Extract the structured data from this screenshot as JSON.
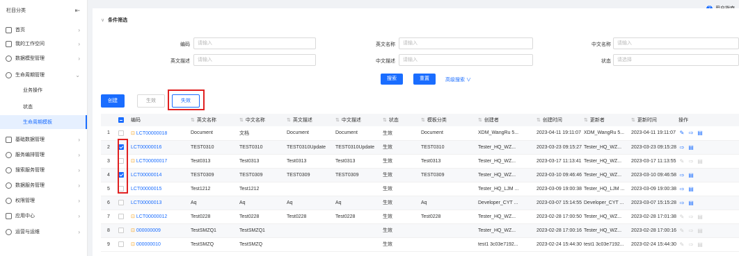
{
  "sidebar": {
    "title": "栏目分类",
    "collapse_icon": "collapse-icon",
    "items": [
      {
        "label": "首页",
        "icon": "home-icon"
      },
      {
        "label": "我的工作空间",
        "icon": "workspace-icon"
      },
      {
        "label": "数据模型管理",
        "icon": "model-icon"
      },
      {
        "label": "生命周期管理",
        "icon": "lifecycle-icon"
      },
      {
        "label": "基础数据管理",
        "icon": "database-icon"
      },
      {
        "label": "服务编排管理",
        "icon": "service-icon"
      },
      {
        "label": "搜索服务管理",
        "icon": "search-service-icon"
      },
      {
        "label": "数据服务管理",
        "icon": "data-service-icon"
      },
      {
        "label": "权限管理",
        "icon": "permission-icon"
      },
      {
        "label": "应用中心",
        "icon": "app-icon"
      },
      {
        "label": "运营与运维",
        "icon": "ops-icon"
      }
    ],
    "sub_items": [
      {
        "label": "业务操作"
      },
      {
        "label": "状态"
      },
      {
        "label": "生命周期模板"
      }
    ]
  },
  "header": {
    "help_label": "用户指南"
  },
  "filter": {
    "title": "条件筛选",
    "fields": [
      {
        "label": "编码",
        "placeholder": "请输入"
      },
      {
        "label": "英文名称",
        "placeholder": "请输入"
      },
      {
        "label": "中文名称",
        "placeholder": "请输入"
      },
      {
        "label": "英文描述",
        "placeholder": "请输入"
      },
      {
        "label": "中文描述",
        "placeholder": "请输入"
      },
      {
        "label": "状态",
        "placeholder": "请选择"
      }
    ],
    "search_label": "搜索",
    "reset_label": "重置",
    "advanced_label": "高级搜索 ∨"
  },
  "toolbar": {
    "create_label": "创建",
    "enable_label": "生效",
    "disable_label": "失效"
  },
  "table": {
    "columns": [
      "编码",
      "英文名称",
      "中文名称",
      "英文描述",
      "中文描述",
      "状态",
      "模板分类",
      "创建者",
      "创建时间",
      "更新者",
      "更新时间",
      "操作"
    ],
    "rows": [
      {
        "no": "1",
        "checked": false,
        "locked": true,
        "code": "LCT00000018",
        "en": "Document",
        "cn": "文档",
        "en_desc": "Document",
        "cn_desc": "Document",
        "status": "生效",
        "category": "Document",
        "creator": "XDM_WangRu 5...",
        "created": "2023-04-11 19:11:07",
        "updater": "XDM_WangRu 5...",
        "updated": "2023-04-11 19:11:07",
        "actions_active": true
      },
      {
        "no": "2",
        "checked": true,
        "locked": false,
        "code": "LCT00000016",
        "en": "TEST0310",
        "cn": "TEST0310",
        "en_desc": "TEST0310Update",
        "cn_desc": "TEST0310Update",
        "status": "生效",
        "category": "TEST0310",
        "creator": "Tester_HQ_WZ...",
        "created": "2023-03-23 09:15:27",
        "updater": "Tester_HQ_WZ...",
        "updated": "2023-03-23 09:15:28",
        "actions_active": true
      },
      {
        "no": "3",
        "checked": false,
        "locked": true,
        "code": "LCT00000017",
        "en": "Test0313",
        "cn": "Test0313",
        "en_desc": "Test0313",
        "cn_desc": "Test0313",
        "status": "生效",
        "category": "Test0313",
        "creator": "Tester_HQ_WZ...",
        "created": "2023-03-17 11:13:41",
        "updater": "Tester_HQ_WZ...",
        "updated": "2023-03-17 11:13:55",
        "actions_active": false
      },
      {
        "no": "4",
        "checked": true,
        "locked": false,
        "code": "LCT00000014",
        "en": "TEST0309",
        "cn": "TEST0309",
        "en_desc": "TEST0309",
        "cn_desc": "TEST0309",
        "status": "生效",
        "category": "TEST0309",
        "creator": "Tester_HQ_WZ...",
        "created": "2023-03-10 09:46:46",
        "updater": "Tester_HQ_WZ...",
        "updated": "2023-03-10 09:46:58",
        "actions_active": true
      },
      {
        "no": "5",
        "checked": false,
        "locked": false,
        "code": "LCT00000015",
        "en": "Test1212",
        "cn": "Test1212",
        "en_desc": "",
        "cn_desc": "",
        "status": "生效",
        "category": "",
        "creator": "Tester_HQ_LJM ...",
        "created": "2023-03-09 19:00:38",
        "updater": "Tester_HQ_LJM ...",
        "updated": "2023-03-09 19:00:38",
        "actions_active": true
      },
      {
        "no": "6",
        "checked": false,
        "locked": false,
        "code": "LCT00000013",
        "en": "Aq",
        "cn": "Aq",
        "en_desc": "Aq",
        "cn_desc": "Aq",
        "status": "生效",
        "category": "Aq",
        "creator": "Developer_CYT ...",
        "created": "2023-03-07 15:14:55",
        "updater": "Developer_CYT ...",
        "updated": "2023-03-07 15:15:28",
        "actions_active": true
      },
      {
        "no": "7",
        "checked": false,
        "locked": true,
        "code": "LCT00000012",
        "en": "Test0228",
        "cn": "Test0228",
        "en_desc": "Test0228",
        "cn_desc": "Test0228",
        "status": "生效",
        "category": "Test0228",
        "creator": "Tester_HQ_WZ...",
        "created": "2023-02-28 17:00:50",
        "updater": "Tester_HQ_WZ...",
        "updated": "2023-02-28 17:01:38",
        "actions_active": false
      },
      {
        "no": "8",
        "checked": false,
        "locked": true,
        "code": "000000009",
        "en": "TestSMZQ1",
        "cn": "TestSMZQ1",
        "en_desc": "",
        "cn_desc": "",
        "status": "生效",
        "category": "",
        "creator": "Tester_HQ_WZ...",
        "created": "2023-02-28 17:00:16",
        "updater": "Tester_HQ_WZ...",
        "updated": "2023-02-28 17:00:16",
        "actions_active": false
      },
      {
        "no": "9",
        "checked": false,
        "locked": true,
        "code": "000000010",
        "en": "TestSMZQ",
        "cn": "TestSMZQ",
        "en_desc": "",
        "cn_desc": "",
        "status": "生效",
        "category": "",
        "creator": "test1 3c03e7192...",
        "created": "2023-02-24 15:44:30",
        "updater": "test1 3c03e7192...",
        "updated": "2023-02-24 15:44:30",
        "actions_active": false
      }
    ]
  }
}
